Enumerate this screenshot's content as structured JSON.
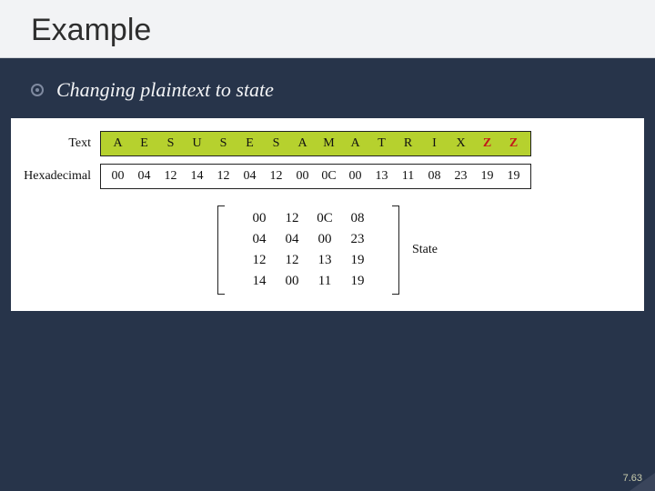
{
  "title": "Example",
  "bullet": "Changing plaintext to state",
  "labels": {
    "text": "Text",
    "hex": "Hexadecimal",
    "state": "State"
  },
  "text_row": [
    "A",
    "E",
    "S",
    "U",
    "S",
    "E",
    "S",
    "A",
    "M",
    "A",
    "T",
    "R",
    "I",
    "X",
    "Z",
    "Z"
  ],
  "text_red_flags": [
    false,
    false,
    false,
    false,
    false,
    false,
    false,
    false,
    false,
    false,
    false,
    false,
    false,
    false,
    true,
    true
  ],
  "hex_row": [
    "00",
    "04",
    "12",
    "14",
    "12",
    "04",
    "12",
    "00",
    "0C",
    "00",
    "13",
    "11",
    "08",
    "23",
    "19",
    "19"
  ],
  "matrix": [
    [
      "00",
      "12",
      "0C",
      "08"
    ],
    [
      "04",
      "04",
      "00",
      "23"
    ],
    [
      "12",
      "12",
      "13",
      "19"
    ],
    [
      "14",
      "00",
      "11",
      "19"
    ]
  ],
  "slide_number": "7.63"
}
